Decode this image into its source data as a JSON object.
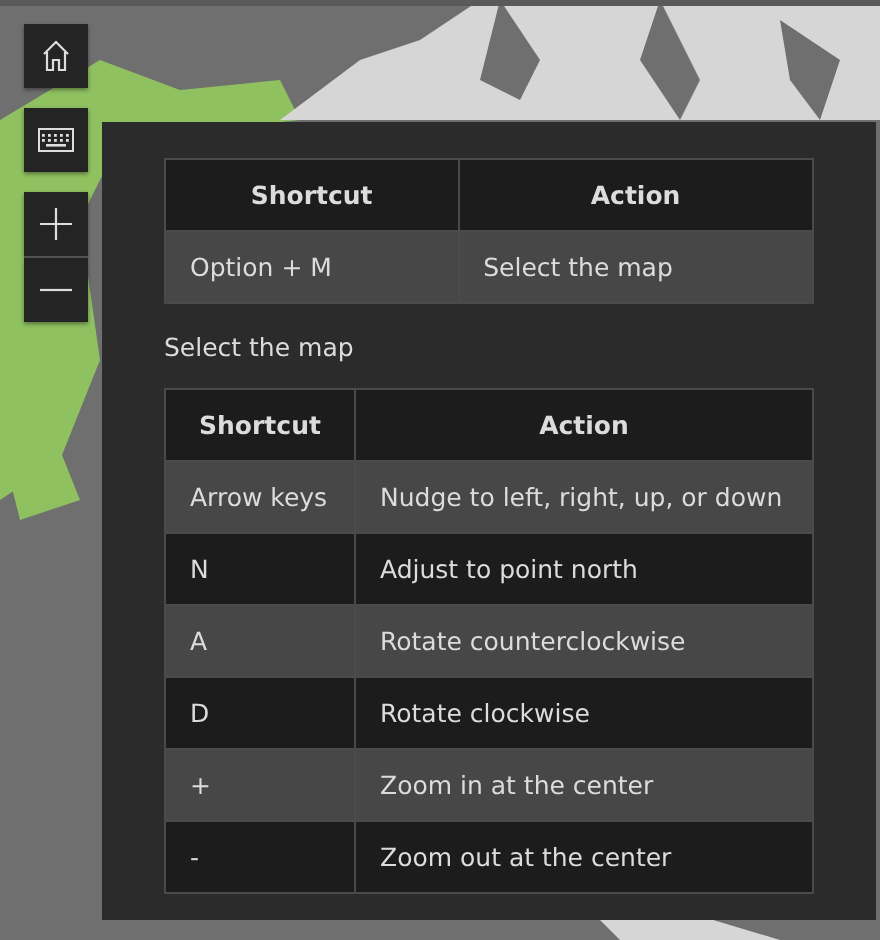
{
  "shortcut_tables": [
    {
      "columns": [
        "Shortcut",
        "Action"
      ],
      "rows": [
        [
          "Option + M",
          "Select the map"
        ]
      ]
    },
    {
      "caption": "Select the map",
      "columns": [
        "Shortcut",
        "Action"
      ],
      "rows": [
        [
          "Arrow keys",
          "Nudge to left, right, up, or down"
        ],
        [
          "N",
          "Adjust to point north"
        ],
        [
          "A",
          "Rotate counterclockwise"
        ],
        [
          "D",
          "Rotate clockwise"
        ],
        [
          "+",
          "Zoom in at the center"
        ],
        [
          "-",
          "Zoom out at the center"
        ]
      ]
    }
  ]
}
